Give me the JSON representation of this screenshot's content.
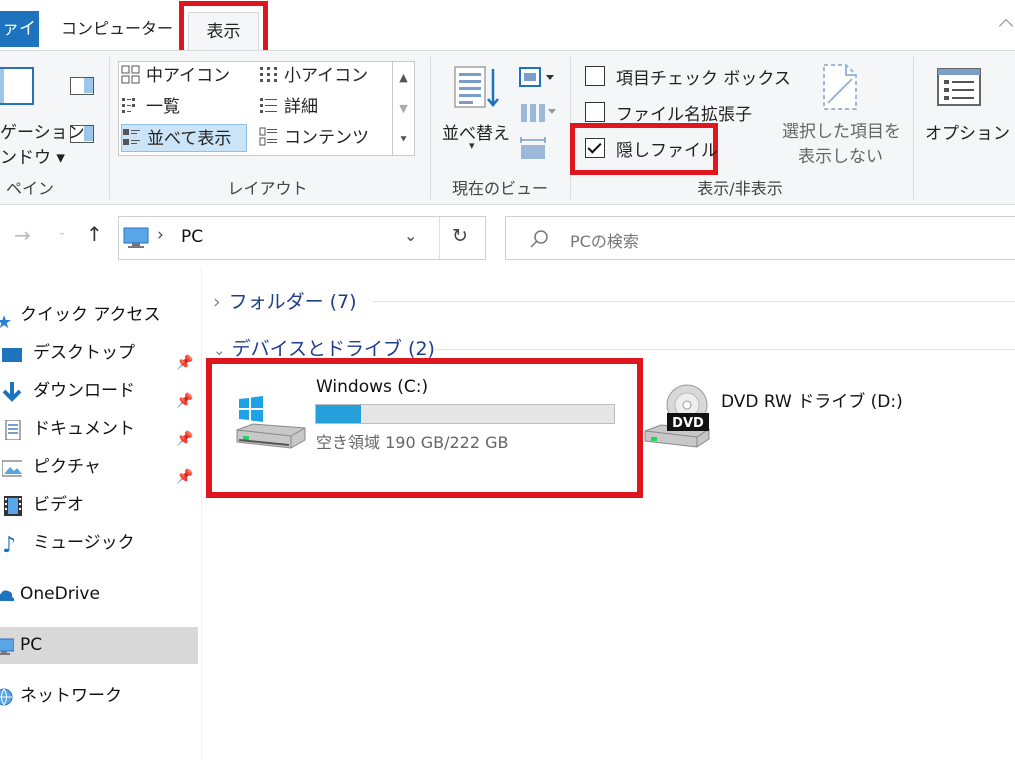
{
  "tabs": {
    "file": "ァイル",
    "computer": "コンピューター",
    "view": "表示"
  },
  "ribbon": {
    "panes": {
      "nav_pane_line1": "ゲーション",
      "nav_pane_line2": "ンドウ",
      "group_label": "ペイン"
    },
    "layout": {
      "items": [
        "中アイコン",
        "小アイコン",
        "一覧",
        "詳細",
        "並べて表示",
        "コンテンツ"
      ],
      "selected": "並べて表示",
      "group_label": "レイアウト"
    },
    "current_view": {
      "sort_label": "並べ替え",
      "group_label": "現在のビュー"
    },
    "show_hide": {
      "item_checkboxes": "項目チェック ボックス",
      "file_extensions": "ファイル名拡張子",
      "hidden_files": "隠しファイル",
      "hidden_files_checked": true,
      "hide_selected_line1": "選択した項目を",
      "hide_selected_line2": "表示しない",
      "group_label": "表示/非表示"
    },
    "options": {
      "label": "オプション"
    }
  },
  "address": {
    "location": "PC",
    "search_placeholder": "PCの検索"
  },
  "sidebar": {
    "items": [
      {
        "label": "クイック アクセス",
        "icon": "star-icon"
      },
      {
        "label": "デスクトップ",
        "icon": "desktop-icon",
        "pinned": true
      },
      {
        "label": "ダウンロード",
        "icon": "download-icon",
        "pinned": true
      },
      {
        "label": "ドキュメント",
        "icon": "document-icon",
        "pinned": true
      },
      {
        "label": "ピクチャ",
        "icon": "picture-icon",
        "pinned": true
      },
      {
        "label": "ビデオ",
        "icon": "video-icon"
      },
      {
        "label": "ミュージック",
        "icon": "music-icon"
      },
      {
        "label": "OneDrive",
        "icon": "cloud-icon"
      },
      {
        "label": "PC",
        "icon": "pc-icon",
        "selected": true
      },
      {
        "label": "ネットワーク",
        "icon": "network-icon"
      }
    ]
  },
  "main": {
    "folders_header": "フォルダー (7)",
    "devices_header": "デバイスとドライブ (2)",
    "drive_c": {
      "name": "Windows (C:)",
      "free_text": "空き領域 190 GB/222 GB",
      "used_fraction": 0.15
    },
    "drive_d": {
      "name": "DVD RW ドライブ (D:)",
      "badge": "DVD"
    }
  },
  "colors": {
    "accent": "#1e73be",
    "highlight_red": "#e0161e",
    "progress_fill": "#26a0da",
    "section_header": "#1e3d8f"
  }
}
